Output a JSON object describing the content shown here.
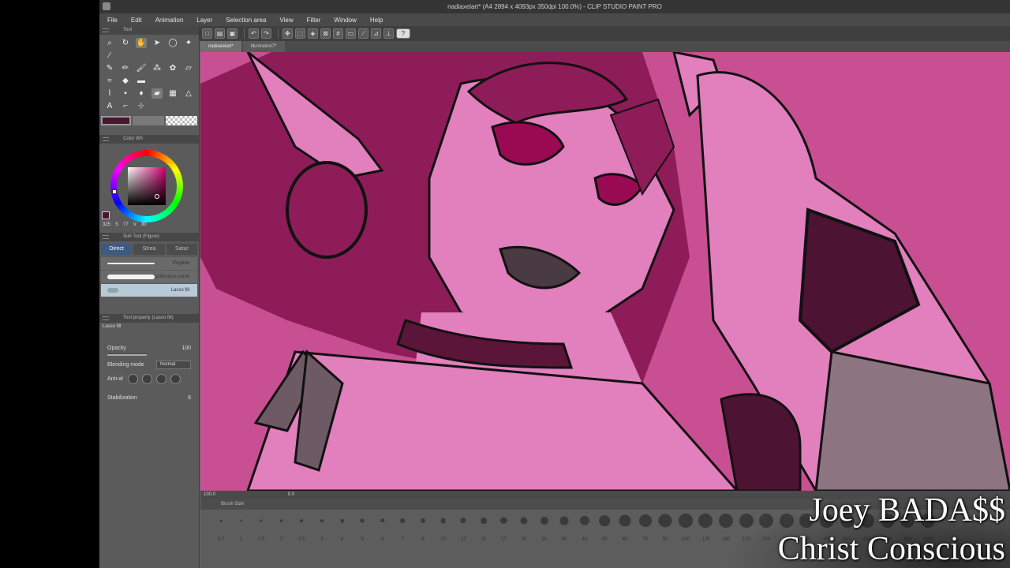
{
  "window": {
    "title": "nadiaxelart* (A4 2894 x 4093px 350dpi 100.0%) - CLIP STUDIO PAINT PRO"
  },
  "menu": [
    "File",
    "Edit",
    "Animation",
    "Layer",
    "Selection area",
    "View",
    "Filter",
    "Window",
    "Help"
  ],
  "canvas_tabs": [
    {
      "label": "nadiaxelart*",
      "active": true
    },
    {
      "label": "Illustration7*",
      "active": false
    }
  ],
  "panels": {
    "tool": {
      "title": "Tool"
    },
    "color_wheel": {
      "title": "Color Wh",
      "h": "325",
      "s": "77",
      "v": "30",
      "labels": {
        "s": "S",
        "v": "V"
      }
    },
    "sub_tool": {
      "title": "Sub Tool (Figure)",
      "tabs": [
        "Direct",
        "Strea",
        "Satur"
      ],
      "items": [
        "Polyline",
        "Continuous curve",
        "Lasso fill"
      ]
    },
    "tool_property": {
      "title": "Tool property (Lasso fill)",
      "name": "Lasso fill",
      "opacity_label": "Opacity",
      "opacity_value": "100",
      "blending_label": "Blending mode",
      "blending_value": "Normal",
      "antialias_label": "Anti-al",
      "stabilization_label": "Stabilization",
      "stabilization_value": "6"
    }
  },
  "colors": {
    "main_color": "#4a1530",
    "canvas_background": "#c94f93"
  },
  "status": {
    "zoom": "100.0",
    "angle": "0.0"
  },
  "brush_size": {
    "title": "Brush Size",
    "sizes": [
      "0.7",
      "1",
      "1.5",
      "2",
      "2.5",
      "3",
      "4",
      "5",
      "6",
      "7",
      "8",
      "10",
      "12",
      "15",
      "17",
      "20",
      "25",
      "30",
      "40",
      "50",
      "60",
      "70",
      "80",
      "100",
      "120",
      "150",
      "170",
      "200",
      "250",
      "300",
      "400",
      "500",
      "600",
      "700",
      "800",
      "1000"
    ]
  },
  "caption": {
    "line1": "Joey BADA$$",
    "line2": "Christ Conscious"
  }
}
